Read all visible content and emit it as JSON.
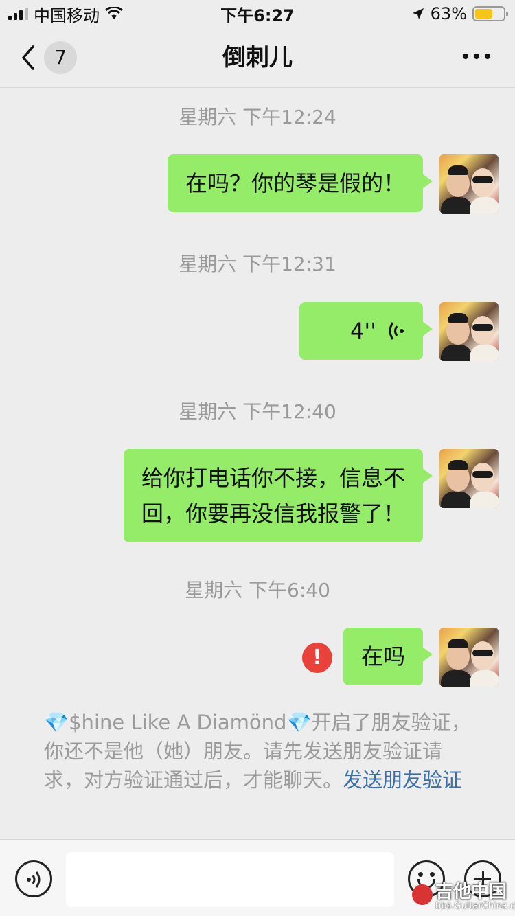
{
  "status_bar": {
    "carrier": "中国移动",
    "time": "下午6:27",
    "battery_percent": "63%",
    "battery_level": 0.63,
    "icons": [
      "signal-icon",
      "wifi-icon",
      "location-arrow-icon",
      "battery-icon"
    ]
  },
  "nav": {
    "back_badge": "7",
    "title": "倒刺儿",
    "icons": [
      "back-chevron-icon",
      "more-icon"
    ]
  },
  "messages": [
    {
      "timestamp": "星期六 下午12:24",
      "type": "text",
      "text": "在吗？你的琴是假的！"
    },
    {
      "timestamp": "星期六 下午12:31",
      "type": "voice",
      "duration": "4''"
    },
    {
      "timestamp": "星期六 下午12:40",
      "type": "text",
      "lines": [
        "给你打电话你不接，信息不",
        "回，你要再没信我报警了！"
      ]
    },
    {
      "timestamp": "星期六 下午6:40",
      "type": "text",
      "text": "在吗",
      "failed": true,
      "error_mark": "!"
    }
  ],
  "system_notice": {
    "diamond": "💎",
    "name": "$hine Like A Diamönd",
    "text": "开启了朋友验证，你还不是他（她）朋友。请先发送朋友验证请求，对方验证通过后，才能聊天。",
    "link": "发送朋友验证"
  },
  "input_bar": {
    "icons": [
      "voice-toggle-icon",
      "emoji-icon",
      "plus-icon"
    ]
  },
  "watermark": {
    "title": "吉他中国",
    "subtitle": "bbs.GuitarChina.com"
  },
  "colors": {
    "background": "#ededed",
    "bubble_self": "#95ec69",
    "error": "#e8423b",
    "link": "#3a6ea8",
    "battery": "#f5c518"
  }
}
